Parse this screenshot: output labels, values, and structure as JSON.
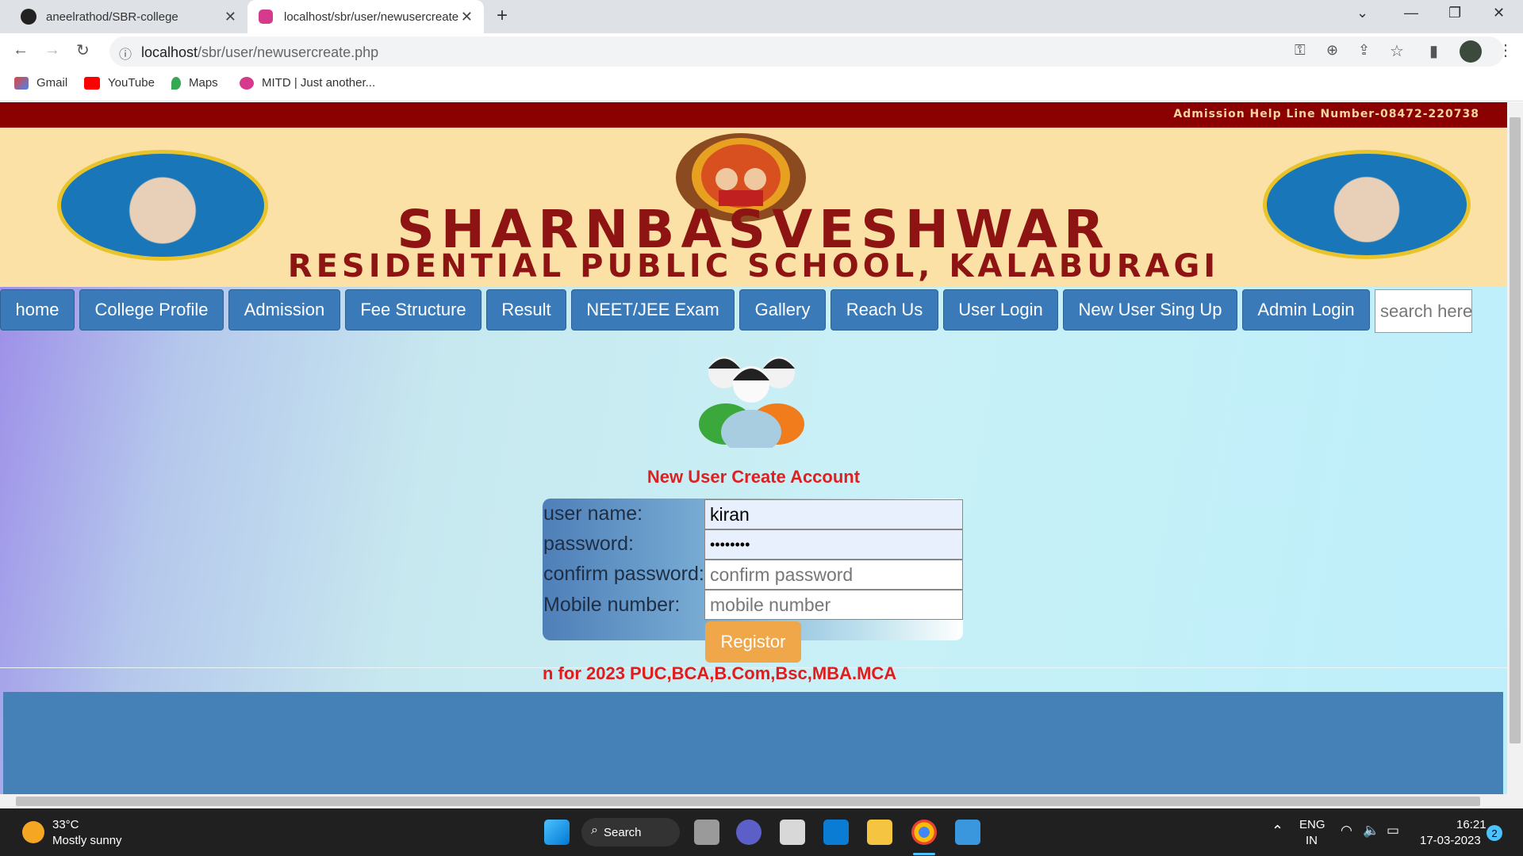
{
  "browser": {
    "tabs": [
      {
        "title": "aneelrathod/SBR-college",
        "icon": "github-icon"
      },
      {
        "title": "localhost/sbr/user/newusercreate.php",
        "icon": "site-icon"
      }
    ],
    "url_host": "localhost",
    "url_path": "/sbr/user/newusercreate.php",
    "bookmarks": [
      "Gmail",
      "YouTube",
      "Maps",
      "MITD | Just another..."
    ]
  },
  "site": {
    "helpline": "Admission Help Line Number-08472-220738",
    "name_line1": "SHARNBASVESHWAR",
    "name_line2": "RESIDENTIAL PUBLIC SCHOOL, KALABURAGI",
    "nav": [
      "home",
      "College Profile",
      "Admission",
      "Fee Structure",
      "Result",
      "NEET/JEE Exam",
      "Gallery",
      "Reach Us",
      "User Login",
      "New User Sing Up",
      "Admin Login"
    ],
    "search_placeholder": "search here"
  },
  "form": {
    "title": "New User Create Account",
    "fields": [
      {
        "label": "user name:",
        "value": "kiran",
        "placeholder": ""
      },
      {
        "label": "password:",
        "value": "••••••••",
        "placeholder": ""
      },
      {
        "label": "confirm password:",
        "value": "",
        "placeholder": "confirm password"
      },
      {
        "label": "Mobile number:",
        "value": "",
        "placeholder": "mobile number"
      }
    ],
    "submit_label": "Registor"
  },
  "marquee": "n for 2023 PUC,BCA,B.Com,Bsc,MBA.MCA",
  "taskbar": {
    "temperature": "33°C",
    "weather": "Mostly sunny",
    "search_label": "Search",
    "lang1": "ENG",
    "lang2": "IN",
    "time": "16:21",
    "date": "17-03-2023",
    "notifications": "2"
  },
  "colors": {
    "topstrip": "#8b0000",
    "banner": "#fbe1a5",
    "nav_button": "#3a7ab8",
    "form_title": "#e02020",
    "register_button": "#f0a74a",
    "footer": "#4581b6"
  }
}
